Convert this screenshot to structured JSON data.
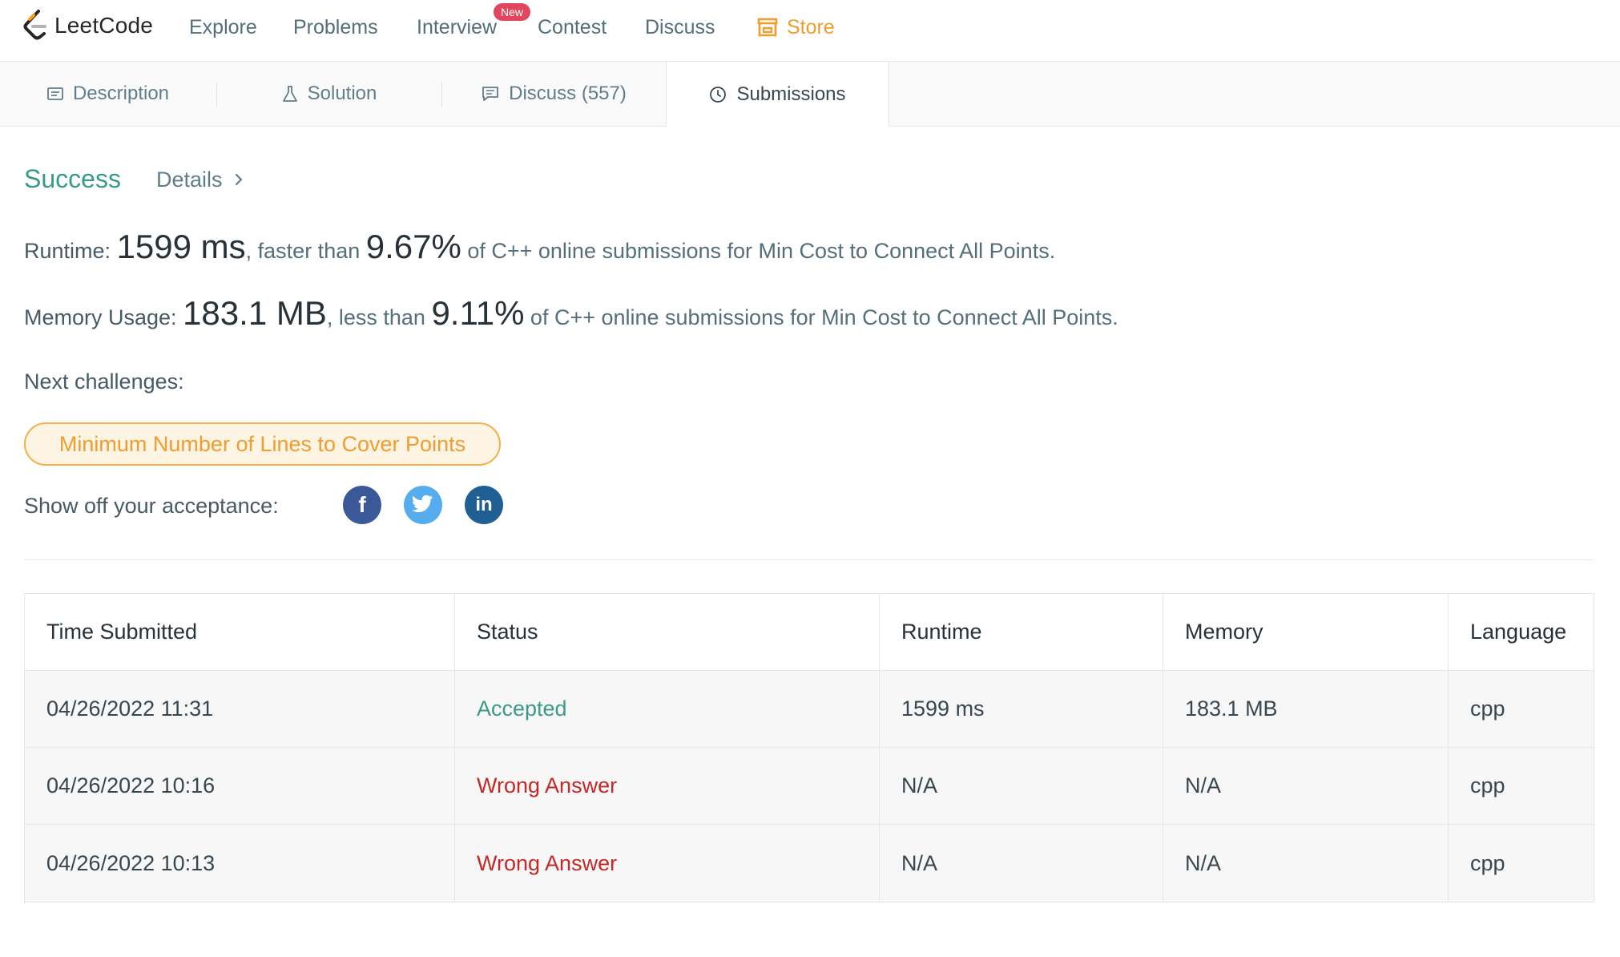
{
  "navbar": {
    "logo_text": "LeetCode",
    "items": [
      "Explore",
      "Problems",
      "Interview",
      "Contest",
      "Discuss"
    ],
    "new_badge": "New",
    "store_label": "Store"
  },
  "tabs": {
    "description": "Description",
    "solution": "Solution",
    "discuss": "Discuss (557)",
    "submissions": "Submissions"
  },
  "result": {
    "status": "Success",
    "details_label": "Details",
    "runtime_label": "Runtime:",
    "runtime_value": "1599 ms",
    "runtime_mid": ", faster than ",
    "runtime_percent": "9.67%",
    "runtime_tail": " of C++ online submissions for Min Cost to Connect All Points.",
    "memory_label": "Memory Usage:",
    "memory_value": "183.1 MB",
    "memory_mid": ", less than ",
    "memory_percent": "9.11%",
    "memory_tail": " of C++ online submissions for Min Cost to Connect All Points.",
    "next_label": "Next challenges:",
    "next_challenge": "Minimum Number of Lines to Cover Points",
    "showoff_label": "Show off your acceptance:"
  },
  "social": {
    "facebook": "f",
    "linkedin": "in"
  },
  "table": {
    "headers": [
      "Time Submitted",
      "Status",
      "Runtime",
      "Memory",
      "Language"
    ],
    "rows": [
      {
        "time": "04/26/2022 11:31",
        "status": "Accepted",
        "runtime": "1599 ms",
        "memory": "183.1 MB",
        "language": "cpp"
      },
      {
        "time": "04/26/2022 10:16",
        "status": "Wrong Answer",
        "runtime": "N/A",
        "memory": "N/A",
        "language": "cpp"
      },
      {
        "time": "04/26/2022 10:13",
        "status": "Wrong Answer",
        "runtime": "N/A",
        "memory": "N/A",
        "language": "cpp"
      }
    ]
  },
  "colors": {
    "accent_green": "#3a9a8a",
    "wrong_red": "#c62828",
    "store_orange": "#ef9d2f",
    "facebook": "#3b5998",
    "twitter": "#55acee",
    "linkedin": "#1f5f94"
  },
  "icons": [
    "leetcode-logo-icon",
    "store-icon",
    "description-icon",
    "flask-icon",
    "comment-icon",
    "clock-icon",
    "chevron-right-icon",
    "facebook-icon",
    "twitter-icon",
    "linkedin-icon"
  ]
}
